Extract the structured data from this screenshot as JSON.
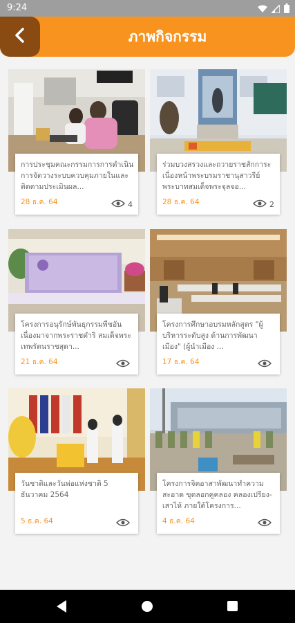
{
  "status": {
    "time": "9:24",
    "icons": [
      "wifi-icon",
      "signal-icon",
      "battery-icon"
    ]
  },
  "header": {
    "title": "ภาพกิจกรรม",
    "back_icon": "chevron-left-icon",
    "color": "#f7931e",
    "back_color": "#8a4b12"
  },
  "cards": [
    {
      "title": "การประชุมคณะกรรมการการดำเนินการจัดวางระบบควบคุมภายในและติดตามประเมินผล...",
      "date": "28 ธ.ค. 64",
      "views": "4"
    },
    {
      "title": "ร่วมบวงสรวงและถวายราชสักการะ เนื่องหน้าพระบรมราชานุสาวรีย์พระบาทสมเด็จพระจุลจอ...",
      "date": "28 ธ.ค. 64",
      "views": "2"
    },
    {
      "title": "โครงการอนุรักษ์พันธุกรรมพืชอันเนื่องมาจากพระราชดำริ สมเด็จพระเทพรัตนราชสุดา...",
      "date": "21 ธ.ค. 64",
      "views": ""
    },
    {
      "title": "โครงการศึกษาอบรมหลักสูตร \"ผู้บริหารระดับสูง ด้านการพัฒนาเมือง\" (ผู้นำเมือง ...",
      "date": "17 ธ.ค. 64",
      "views": ""
    },
    {
      "title": "วันชาติและวันพ่อแห่งชาติ 5 ธันวาคม 2564",
      "date": "5 ธ.ค. 64",
      "views": ""
    },
    {
      "title": "โครงการจิตอาสาพัฒนาทำความสะอาด ขุดลอกคูคลอง คลองเปรียง-เสาไห้ ภายใต้โครงการ...",
      "date": "4 ธ.ค. 64",
      "views": ""
    }
  ],
  "nav": {
    "back": "nav-back-icon",
    "home": "nav-home-icon",
    "recents": "nav-recents-icon"
  }
}
